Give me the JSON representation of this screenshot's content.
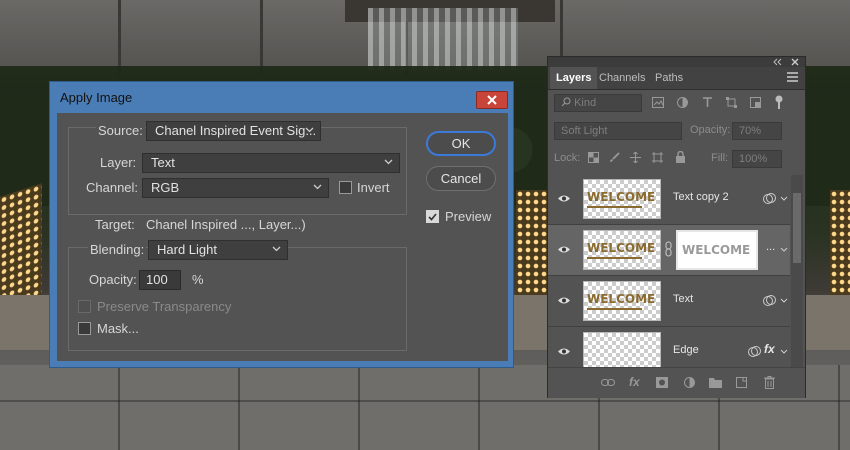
{
  "dialog": {
    "title": "Apply Image",
    "source_label": "Source:",
    "source_value": "Chanel Inspired Event Sig...",
    "layer_label": "Layer:",
    "layer_value": "Text",
    "channel_label": "Channel:",
    "channel_value": "RGB",
    "invert_label": "Invert",
    "invert_checked": false,
    "target_label": "Target:",
    "target_value": "Chanel Inspired ..., Layer...)",
    "blending_label": "Blending:",
    "blending_value": "Hard Light",
    "opacity_label": "Opacity:",
    "opacity_value": "100",
    "opacity_unit": "%",
    "preserve_label": "Preserve Transparency",
    "preserve_enabled": false,
    "mask_label": "Mask...",
    "mask_checked": false,
    "ok_label": "OK",
    "cancel_label": "Cancel",
    "preview_label": "Preview",
    "preview_checked": true
  },
  "layers_panel": {
    "tabs": [
      "Layers",
      "Channels",
      "Paths"
    ],
    "active_tab": "Layers",
    "filter_kind": "Kind",
    "blend_mode": "Soft Light",
    "opacity_label": "Opacity:",
    "opacity_value": "70%",
    "lock_label": "Lock:",
    "fill_label": "Fill:",
    "fill_value": "100%",
    "layers": [
      {
        "name": "Text copy 2",
        "thumb_text": "WELCOME",
        "has_mask": false,
        "selected": false
      },
      {
        "name": "",
        "thumb_text": "WELCOME",
        "mask_text": "WELCOME",
        "has_mask": true,
        "selected": true,
        "mask_ellipsis": "..."
      },
      {
        "name": "Text",
        "thumb_text": "WELCOME",
        "has_mask": false,
        "selected": false
      },
      {
        "name": "Edge",
        "thumb_text": "",
        "has_mask": false,
        "selected": false,
        "fx": "fx"
      }
    ]
  },
  "colors": {
    "dialog_title_bar": "#4a7cb5",
    "close_button": "#c9453a",
    "primary_button_outline": "#3b7ad9",
    "panel_bg": "#535353",
    "thumb_text": "#8a6a2e"
  }
}
